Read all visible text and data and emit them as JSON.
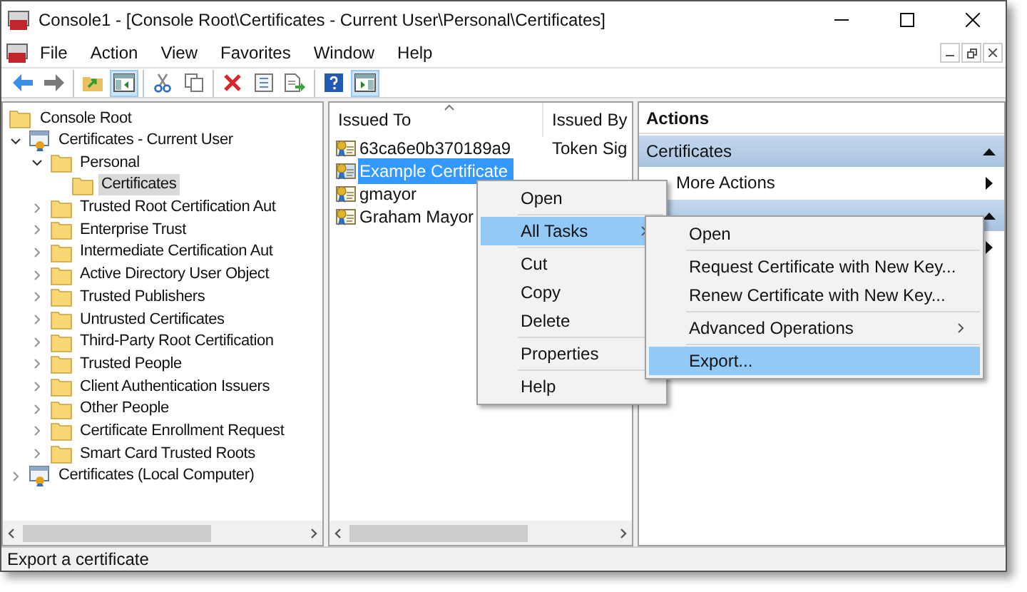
{
  "window": {
    "title": "Console1 - [Console Root\\Certificates - Current User\\Personal\\Certificates]"
  },
  "menu": [
    "File",
    "Action",
    "View",
    "Favorites",
    "Window",
    "Help"
  ],
  "toolbar": [
    [
      {
        "kind": "back",
        "pressed": false
      },
      {
        "kind": "forward",
        "pressed": false
      }
    ],
    [
      {
        "kind": "up",
        "pressed": false
      },
      {
        "kind": "tree",
        "pressed": true
      }
    ],
    [
      {
        "kind": "cut",
        "pressed": false
      },
      {
        "kind": "copy",
        "pressed": false
      }
    ],
    [
      {
        "kind": "delete",
        "pressed": false
      },
      {
        "kind": "properties",
        "pressed": false
      },
      {
        "kind": "export",
        "pressed": false
      }
    ],
    [
      {
        "kind": "help",
        "pressed": false
      },
      {
        "kind": "actionpane",
        "pressed": true
      }
    ]
  ],
  "tree": [
    {
      "label": "Console Root",
      "kind": "folder",
      "selected": false,
      "children": [
        {
          "label": "Certificates - Current User",
          "kind": "snapin",
          "selected": false,
          "expanded": true,
          "children": [
            {
              "label": "Personal",
              "kind": "folder",
              "selected": false,
              "expanded": true,
              "children": [
                {
                  "label": "Certificates",
                  "kind": "folder",
                  "selected": true
                }
              ]
            },
            {
              "label": "Trusted Root Certification Aut",
              "kind": "folder",
              "selected": false,
              "expanded": false
            },
            {
              "label": "Enterprise Trust",
              "kind": "folder",
              "selected": false,
              "expanded": false
            },
            {
              "label": "Intermediate Certification Aut",
              "kind": "folder",
              "selected": false,
              "expanded": false
            },
            {
              "label": "Active Directory User Object",
              "kind": "folder",
              "selected": false,
              "expanded": false
            },
            {
              "label": "Trusted Publishers",
              "kind": "folder",
              "selected": false,
              "expanded": false
            },
            {
              "label": "Untrusted Certificates",
              "kind": "folder",
              "selected": false,
              "expanded": false
            },
            {
              "label": "Third-Party Root Certification",
              "kind": "folder",
              "selected": false,
              "expanded": false
            },
            {
              "label": "Trusted People",
              "kind": "folder",
              "selected": false,
              "expanded": false
            },
            {
              "label": "Client Authentication Issuers",
              "kind": "folder",
              "selected": false,
              "expanded": false
            },
            {
              "label": "Other People",
              "kind": "folder",
              "selected": false,
              "expanded": false
            },
            {
              "label": "Certificate Enrollment Request",
              "kind": "folder",
              "selected": false,
              "expanded": false
            },
            {
              "label": "Smart Card Trusted Roots",
              "kind": "folder",
              "selected": false,
              "expanded": false
            }
          ]
        },
        {
          "label": "Certificates (Local Computer)",
          "kind": "snapin",
          "selected": false,
          "expanded": false
        }
      ]
    }
  ],
  "list": {
    "columns": [
      "Issued To",
      "Issued By"
    ],
    "rows": [
      {
        "issued_to": "63ca6e0b370189a9",
        "issued_by": "Token Sig",
        "selected": false
      },
      {
        "issued_to": "Example Certificate",
        "selected": true
      },
      {
        "issued_to": "gmayor",
        "selected": false
      },
      {
        "issued_to": "Graham Mayor",
        "selected": false
      }
    ]
  },
  "actions": {
    "title": "Actions",
    "sections": [
      {
        "header": "Certificates",
        "expanded": true,
        "items": [
          "More Actions"
        ]
      },
      {
        "expanded": true
      }
    ]
  },
  "context_menu": {
    "groups": [
      [
        {
          "label": "Open",
          "selected": false
        }
      ],
      [
        {
          "label": "All Tasks",
          "selected": true,
          "submenu": true
        }
      ],
      [
        {
          "label": "Cut",
          "selected": false
        },
        {
          "label": "Copy",
          "selected": false
        },
        {
          "label": "Delete",
          "selected": false
        }
      ],
      [
        {
          "label": "Properties",
          "selected": false
        }
      ],
      [
        {
          "label": "Help",
          "selected": false
        }
      ]
    ]
  },
  "submenu": {
    "groups": [
      [
        {
          "label": "Open",
          "selected": false
        }
      ],
      [
        {
          "label": "Request Certificate with New Key...",
          "selected": false
        },
        {
          "label": "Renew Certificate with New Key...",
          "selected": false
        }
      ],
      [
        {
          "label": "Advanced Operations",
          "selected": false,
          "submenu": true
        }
      ],
      [
        {
          "label": "Export...",
          "selected": true
        }
      ]
    ]
  },
  "status_bar": "Export a certificate"
}
